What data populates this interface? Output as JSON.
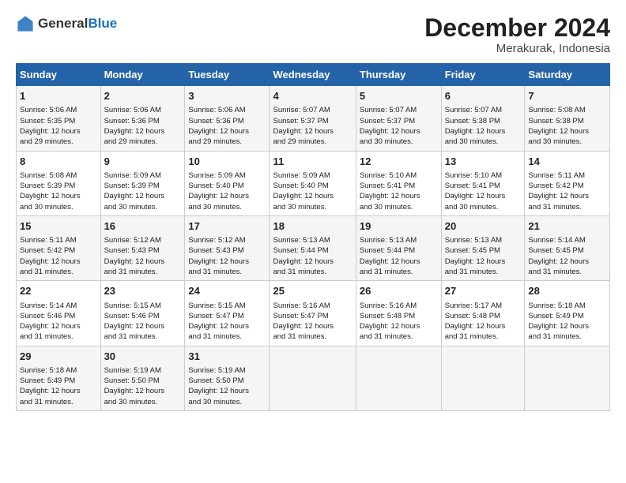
{
  "header": {
    "logo_general": "General",
    "logo_blue": "Blue",
    "title": "December 2024",
    "location": "Merakurak, Indonesia"
  },
  "columns": [
    "Sunday",
    "Monday",
    "Tuesday",
    "Wednesday",
    "Thursday",
    "Friday",
    "Saturday"
  ],
  "weeks": [
    [
      {
        "day": "1",
        "lines": [
          "Sunrise: 5:06 AM",
          "Sunset: 5:35 PM",
          "Daylight: 12 hours",
          "and 29 minutes."
        ]
      },
      {
        "day": "2",
        "lines": [
          "Sunrise: 5:06 AM",
          "Sunset: 5:36 PM",
          "Daylight: 12 hours",
          "and 29 minutes."
        ]
      },
      {
        "day": "3",
        "lines": [
          "Sunrise: 5:06 AM",
          "Sunset: 5:36 PM",
          "Daylight: 12 hours",
          "and 29 minutes."
        ]
      },
      {
        "day": "4",
        "lines": [
          "Sunrise: 5:07 AM",
          "Sunset: 5:37 PM",
          "Daylight: 12 hours",
          "and 29 minutes."
        ]
      },
      {
        "day": "5",
        "lines": [
          "Sunrise: 5:07 AM",
          "Sunset: 5:37 PM",
          "Daylight: 12 hours",
          "and 30 minutes."
        ]
      },
      {
        "day": "6",
        "lines": [
          "Sunrise: 5:07 AM",
          "Sunset: 5:38 PM",
          "Daylight: 12 hours",
          "and 30 minutes."
        ]
      },
      {
        "day": "7",
        "lines": [
          "Sunrise: 5:08 AM",
          "Sunset: 5:38 PM",
          "Daylight: 12 hours",
          "and 30 minutes."
        ]
      }
    ],
    [
      {
        "day": "8",
        "lines": [
          "Sunrise: 5:08 AM",
          "Sunset: 5:39 PM",
          "Daylight: 12 hours",
          "and 30 minutes."
        ]
      },
      {
        "day": "9",
        "lines": [
          "Sunrise: 5:09 AM",
          "Sunset: 5:39 PM",
          "Daylight: 12 hours",
          "and 30 minutes."
        ]
      },
      {
        "day": "10",
        "lines": [
          "Sunrise: 5:09 AM",
          "Sunset: 5:40 PM",
          "Daylight: 12 hours",
          "and 30 minutes."
        ]
      },
      {
        "day": "11",
        "lines": [
          "Sunrise: 5:09 AM",
          "Sunset: 5:40 PM",
          "Daylight: 12 hours",
          "and 30 minutes."
        ]
      },
      {
        "day": "12",
        "lines": [
          "Sunrise: 5:10 AM",
          "Sunset: 5:41 PM",
          "Daylight: 12 hours",
          "and 30 minutes."
        ]
      },
      {
        "day": "13",
        "lines": [
          "Sunrise: 5:10 AM",
          "Sunset: 5:41 PM",
          "Daylight: 12 hours",
          "and 30 minutes."
        ]
      },
      {
        "day": "14",
        "lines": [
          "Sunrise: 5:11 AM",
          "Sunset: 5:42 PM",
          "Daylight: 12 hours",
          "and 31 minutes."
        ]
      }
    ],
    [
      {
        "day": "15",
        "lines": [
          "Sunrise: 5:11 AM",
          "Sunset: 5:42 PM",
          "Daylight: 12 hours",
          "and 31 minutes."
        ]
      },
      {
        "day": "16",
        "lines": [
          "Sunrise: 5:12 AM",
          "Sunset: 5:43 PM",
          "Daylight: 12 hours",
          "and 31 minutes."
        ]
      },
      {
        "day": "17",
        "lines": [
          "Sunrise: 5:12 AM",
          "Sunset: 5:43 PM",
          "Daylight: 12 hours",
          "and 31 minutes."
        ]
      },
      {
        "day": "18",
        "lines": [
          "Sunrise: 5:13 AM",
          "Sunset: 5:44 PM",
          "Daylight: 12 hours",
          "and 31 minutes."
        ]
      },
      {
        "day": "19",
        "lines": [
          "Sunrise: 5:13 AM",
          "Sunset: 5:44 PM",
          "Daylight: 12 hours",
          "and 31 minutes."
        ]
      },
      {
        "day": "20",
        "lines": [
          "Sunrise: 5:13 AM",
          "Sunset: 5:45 PM",
          "Daylight: 12 hours",
          "and 31 minutes."
        ]
      },
      {
        "day": "21",
        "lines": [
          "Sunrise: 5:14 AM",
          "Sunset: 5:45 PM",
          "Daylight: 12 hours",
          "and 31 minutes."
        ]
      }
    ],
    [
      {
        "day": "22",
        "lines": [
          "Sunrise: 5:14 AM",
          "Sunset: 5:46 PM",
          "Daylight: 12 hours",
          "and 31 minutes."
        ]
      },
      {
        "day": "23",
        "lines": [
          "Sunrise: 5:15 AM",
          "Sunset: 5:46 PM",
          "Daylight: 12 hours",
          "and 31 minutes."
        ]
      },
      {
        "day": "24",
        "lines": [
          "Sunrise: 5:15 AM",
          "Sunset: 5:47 PM",
          "Daylight: 12 hours",
          "and 31 minutes."
        ]
      },
      {
        "day": "25",
        "lines": [
          "Sunrise: 5:16 AM",
          "Sunset: 5:47 PM",
          "Daylight: 12 hours",
          "and 31 minutes."
        ]
      },
      {
        "day": "26",
        "lines": [
          "Sunrise: 5:16 AM",
          "Sunset: 5:48 PM",
          "Daylight: 12 hours",
          "and 31 minutes."
        ]
      },
      {
        "day": "27",
        "lines": [
          "Sunrise: 5:17 AM",
          "Sunset: 5:48 PM",
          "Daylight: 12 hours",
          "and 31 minutes."
        ]
      },
      {
        "day": "28",
        "lines": [
          "Sunrise: 5:18 AM",
          "Sunset: 5:49 PM",
          "Daylight: 12 hours",
          "and 31 minutes."
        ]
      }
    ],
    [
      {
        "day": "29",
        "lines": [
          "Sunrise: 5:18 AM",
          "Sunset: 5:49 PM",
          "Daylight: 12 hours",
          "and 31 minutes."
        ]
      },
      {
        "day": "30",
        "lines": [
          "Sunrise: 5:19 AM",
          "Sunset: 5:50 PM",
          "Daylight: 12 hours",
          "and 30 minutes."
        ]
      },
      {
        "day": "31",
        "lines": [
          "Sunrise: 5:19 AM",
          "Sunset: 5:50 PM",
          "Daylight: 12 hours",
          "and 30 minutes."
        ]
      },
      null,
      null,
      null,
      null
    ]
  ]
}
